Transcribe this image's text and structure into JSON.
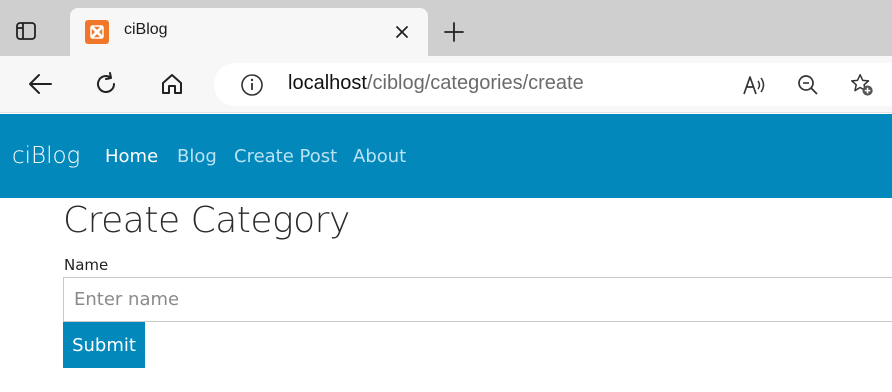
{
  "browser": {
    "tab_title": "ciBlog",
    "url_host": "localhost",
    "url_path": "/ciblog/categories/create",
    "icons": {
      "tab_actions": "tab-actions-icon",
      "favicon": "xampp-favicon-icon",
      "close": "close-icon",
      "new_tab": "plus-icon",
      "back": "back-arrow-icon",
      "refresh": "refresh-icon",
      "home": "home-icon",
      "site_info": "info-icon",
      "read_aloud": "read-aloud-icon",
      "zoom": "zoom-out-icon",
      "favorites": "add-favorite-icon"
    },
    "colors": {
      "favicon": "#f0772a",
      "tabstrip": "#cfcfcf",
      "toolbar": "#f7f7f7"
    }
  },
  "navbar": {
    "brand": "ciBlog",
    "links": [
      {
        "label": "Home",
        "active": true
      },
      {
        "label": "Blog",
        "active": false
      },
      {
        "label": "Create Post",
        "active": false
      },
      {
        "label": "About",
        "active": false
      }
    ],
    "color": "#0388bb"
  },
  "form": {
    "title": "Create Category",
    "name_label": "Name",
    "name_value": "",
    "name_placeholder": "Enter name",
    "submit_label": "Submit"
  }
}
